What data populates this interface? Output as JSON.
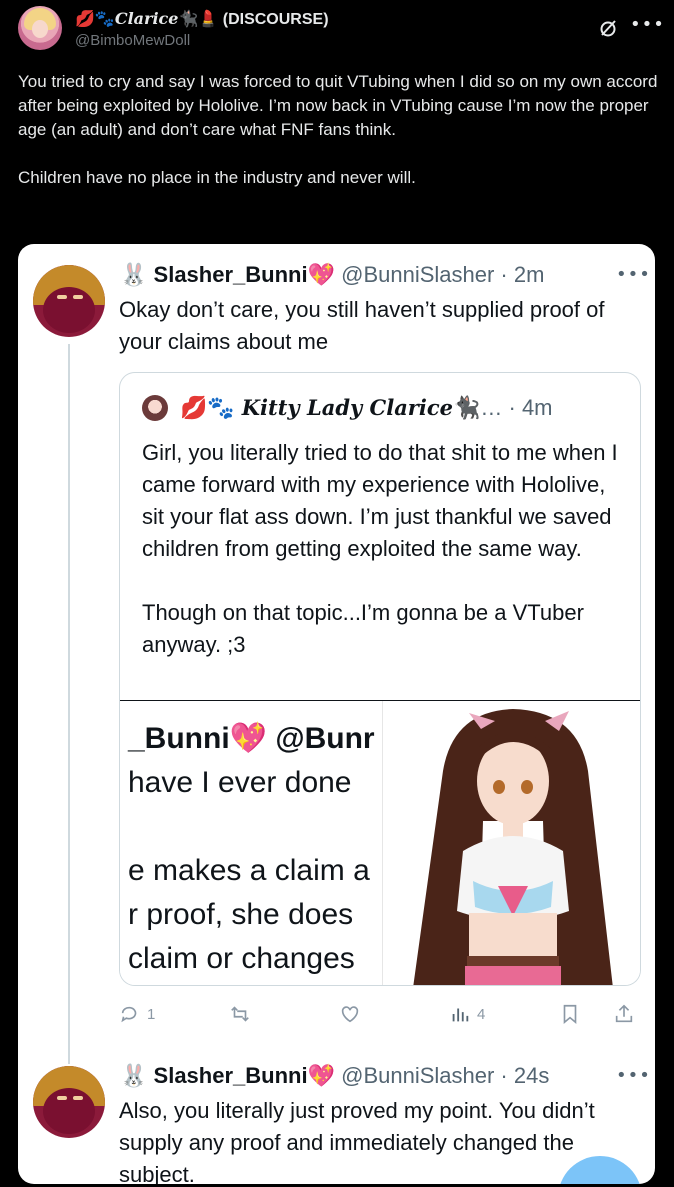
{
  "outer": {
    "display_name_prefix": "💋🐾",
    "display_name_main": "Clarice",
    "display_name_suffix": "🐈‍⬛💄",
    "display_name_tag": "(DISCOURSE)",
    "handle": "@BimboMewDoll",
    "paragraphs": [
      "You tried to cry and say I was forced to quit VTubing when I did so on my own accord after being exploited by Hololive.  I’m now back in VTubing cause I’m now the proper age (an adult) and don’t care what FNF fans think.",
      "Children have no place in the industry and never will."
    ]
  },
  "reply1": {
    "name_emoji": "🐰",
    "name": "Slasher_Bunni",
    "heart": "💖",
    "handle_time": "@BunniSlasher · 2m",
    "text": "Okay don’t care, you still haven’t supplied proof of your claims about me"
  },
  "quote": {
    "name_prefix": "💋🐾",
    "name_main": "Kitty Lady Clarice",
    "name_suffix": "🐈‍⬛… · 4m",
    "paragraphs": [
      "Girl, you literally tried to do that shit to me when I came forward with my experience with Hololive, sit your flat ass down.  I’m just thankful we saved children from getting exploited the same way.",
      "Though on that topic...I’m gonna be a VTuber anyway. ;3"
    ],
    "screenshot_lines": [
      "_Bunni💖 @Bunr",
      "have I ever done",
      "",
      "e makes a claim a",
      "r proof, she does",
      "claim or changes"
    ]
  },
  "actions": {
    "replies": "1",
    "retweets": "",
    "likes": "",
    "views": "4"
  },
  "reply2": {
    "name_emoji": "🐰",
    "name": "Slasher_Bunni",
    "heart": "💖",
    "handle_time": "@BunniSlasher · 24s",
    "text": "Also, you literally just proved my point. You didn’t supply any proof and immediately changed the subject."
  },
  "colors": {
    "background": "#000000",
    "card": "#ffffff",
    "muted": "#536471",
    "reply_fab": "#7cc4f8"
  }
}
